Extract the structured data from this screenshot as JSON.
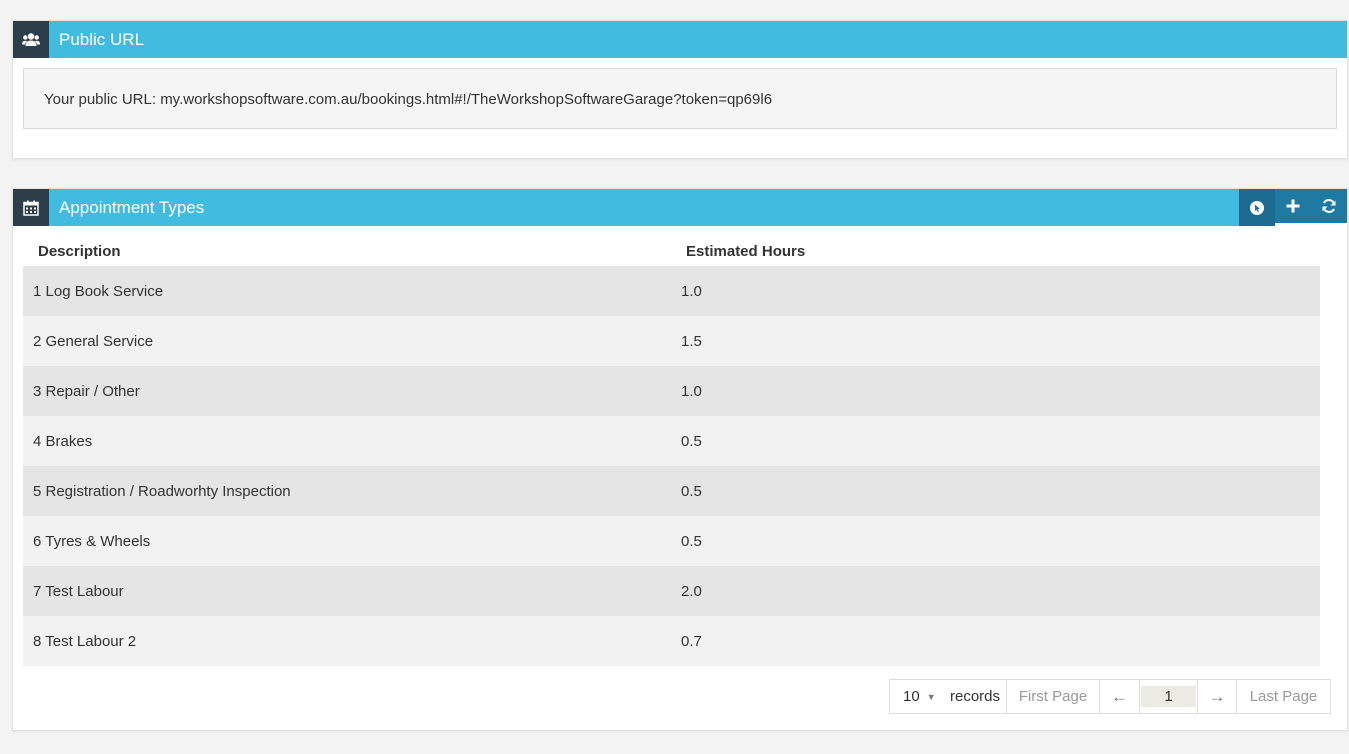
{
  "public_url_panel": {
    "icon": "users-icon",
    "title": "Public URL",
    "label": "Your public URL:",
    "url": "my.workshopsoftware.com.au/bookings.html#!/TheWorkshopSoftwareGarage?token=qp69l6"
  },
  "appointment_panel": {
    "icon": "calendar-icon",
    "title": "Appointment Types",
    "tools": [
      "cursor-icon",
      "plus-icon",
      "refresh-icon"
    ],
    "columns": {
      "description": "Description",
      "hours": "Estimated Hours"
    },
    "rows": [
      {
        "description": "1 Log Book Service",
        "hours": "1.0"
      },
      {
        "description": "2 General Service",
        "hours": "1.5"
      },
      {
        "description": "3 Repair / Other",
        "hours": "1.0"
      },
      {
        "description": "4 Brakes",
        "hours": "0.5"
      },
      {
        "description": "5 Registration / Roadworhty Inspection",
        "hours": "0.5"
      },
      {
        "description": "6 Tyres & Wheels",
        "hours": "0.5"
      },
      {
        "description": "7 Test Labour",
        "hours": "2.0"
      },
      {
        "description": "8 Test Labour 2",
        "hours": "0.7"
      }
    ],
    "pager": {
      "page_size": "10",
      "records_label": "records",
      "first_label": "First Page",
      "prev_arrow": "←",
      "current_page": "1",
      "next_arrow": "→",
      "last_label": "Last Page"
    }
  },
  "colors": {
    "header_bg": "#41bbe0",
    "icon_bg": "#2d3e4a",
    "tools_bg": "#1f7aa3"
  }
}
